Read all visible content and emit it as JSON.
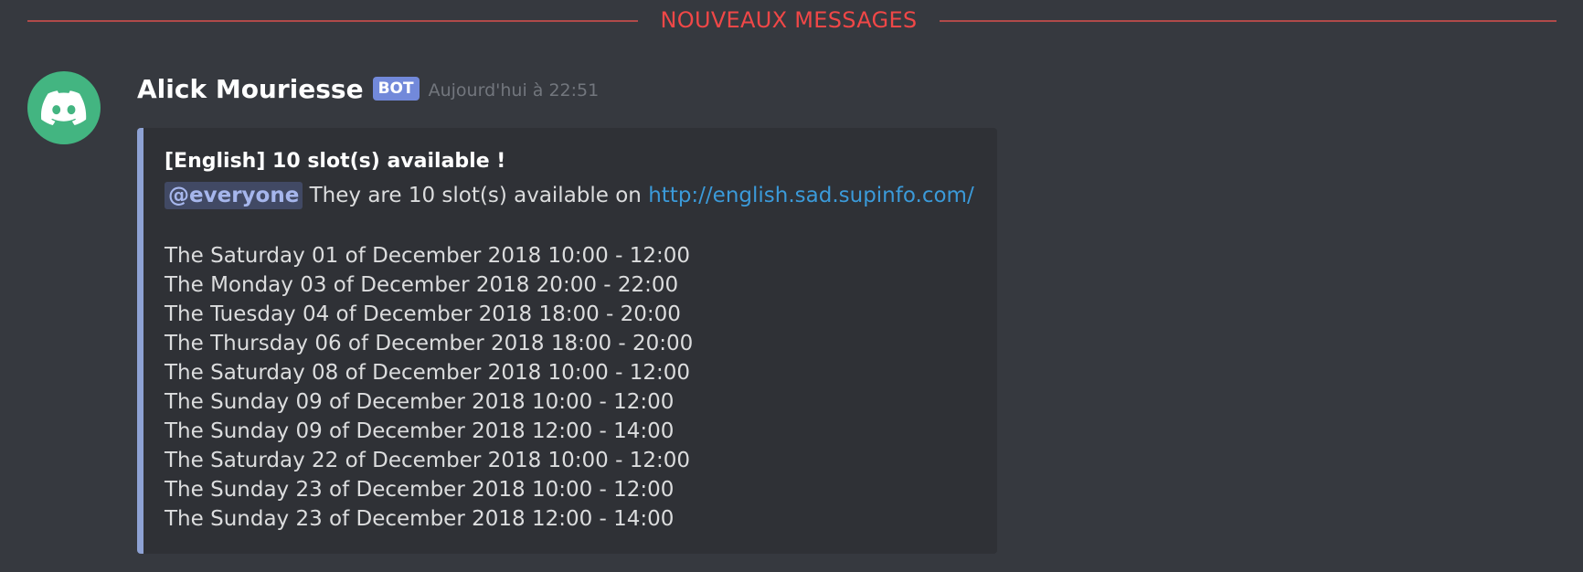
{
  "divider": {
    "label": "NOUVEAUX MESSAGES"
  },
  "message": {
    "author": "Alick Mouriesse",
    "bot_tag": "BOT",
    "timestamp": "Aujourd'hui à 22:51",
    "avatar_icon": "discord-logo-icon",
    "avatar_color": "#43b581",
    "embed": {
      "accent_color": "#8ea2d4",
      "title": "[English] 10 slot(s) available !",
      "mention": "@everyone",
      "description": "They are 10 slot(s) available on",
      "link": "http://english.sad.supinfo.com/",
      "slots": [
        "The Saturday 01 of December 2018 10:00 - 12:00",
        "The Monday 03 of December 2018 20:00 - 22:00",
        "The Tuesday 04 of December 2018 18:00 - 20:00",
        "The Thursday 06 of December 2018 18:00 - 20:00",
        "The Saturday 08 of December 2018 10:00 - 12:00",
        "The Sunday 09 of December 2018 10:00 - 12:00",
        "The Sunday 09 of December 2018 12:00 - 14:00",
        "The Saturday 22 of December 2018 10:00 - 12:00",
        "The Sunday 23 of December 2018 10:00 - 12:00",
        "The Sunday 23 of December 2018 12:00 - 14:00"
      ]
    }
  }
}
